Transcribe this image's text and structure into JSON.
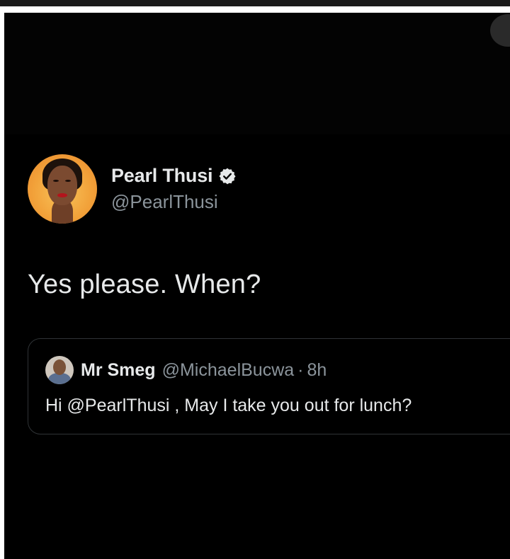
{
  "tweet": {
    "author": {
      "display_name": "Pearl Thusi",
      "handle": "@PearlThusi",
      "verified": true
    },
    "text": "Yes please. When?"
  },
  "quoted_tweet": {
    "author": {
      "display_name": "Mr Smeg",
      "handle": "@MichaelBucwa"
    },
    "separator": "·",
    "time": "8h",
    "text": "Hi @PearlThusi , May I take you out for lunch?"
  },
  "colors": {
    "background": "#000000",
    "primary_text": "#e7e9ea",
    "secondary_text": "#8b949b",
    "border": "#2f3336"
  },
  "icons": {
    "verified": "verified-badge-icon"
  }
}
